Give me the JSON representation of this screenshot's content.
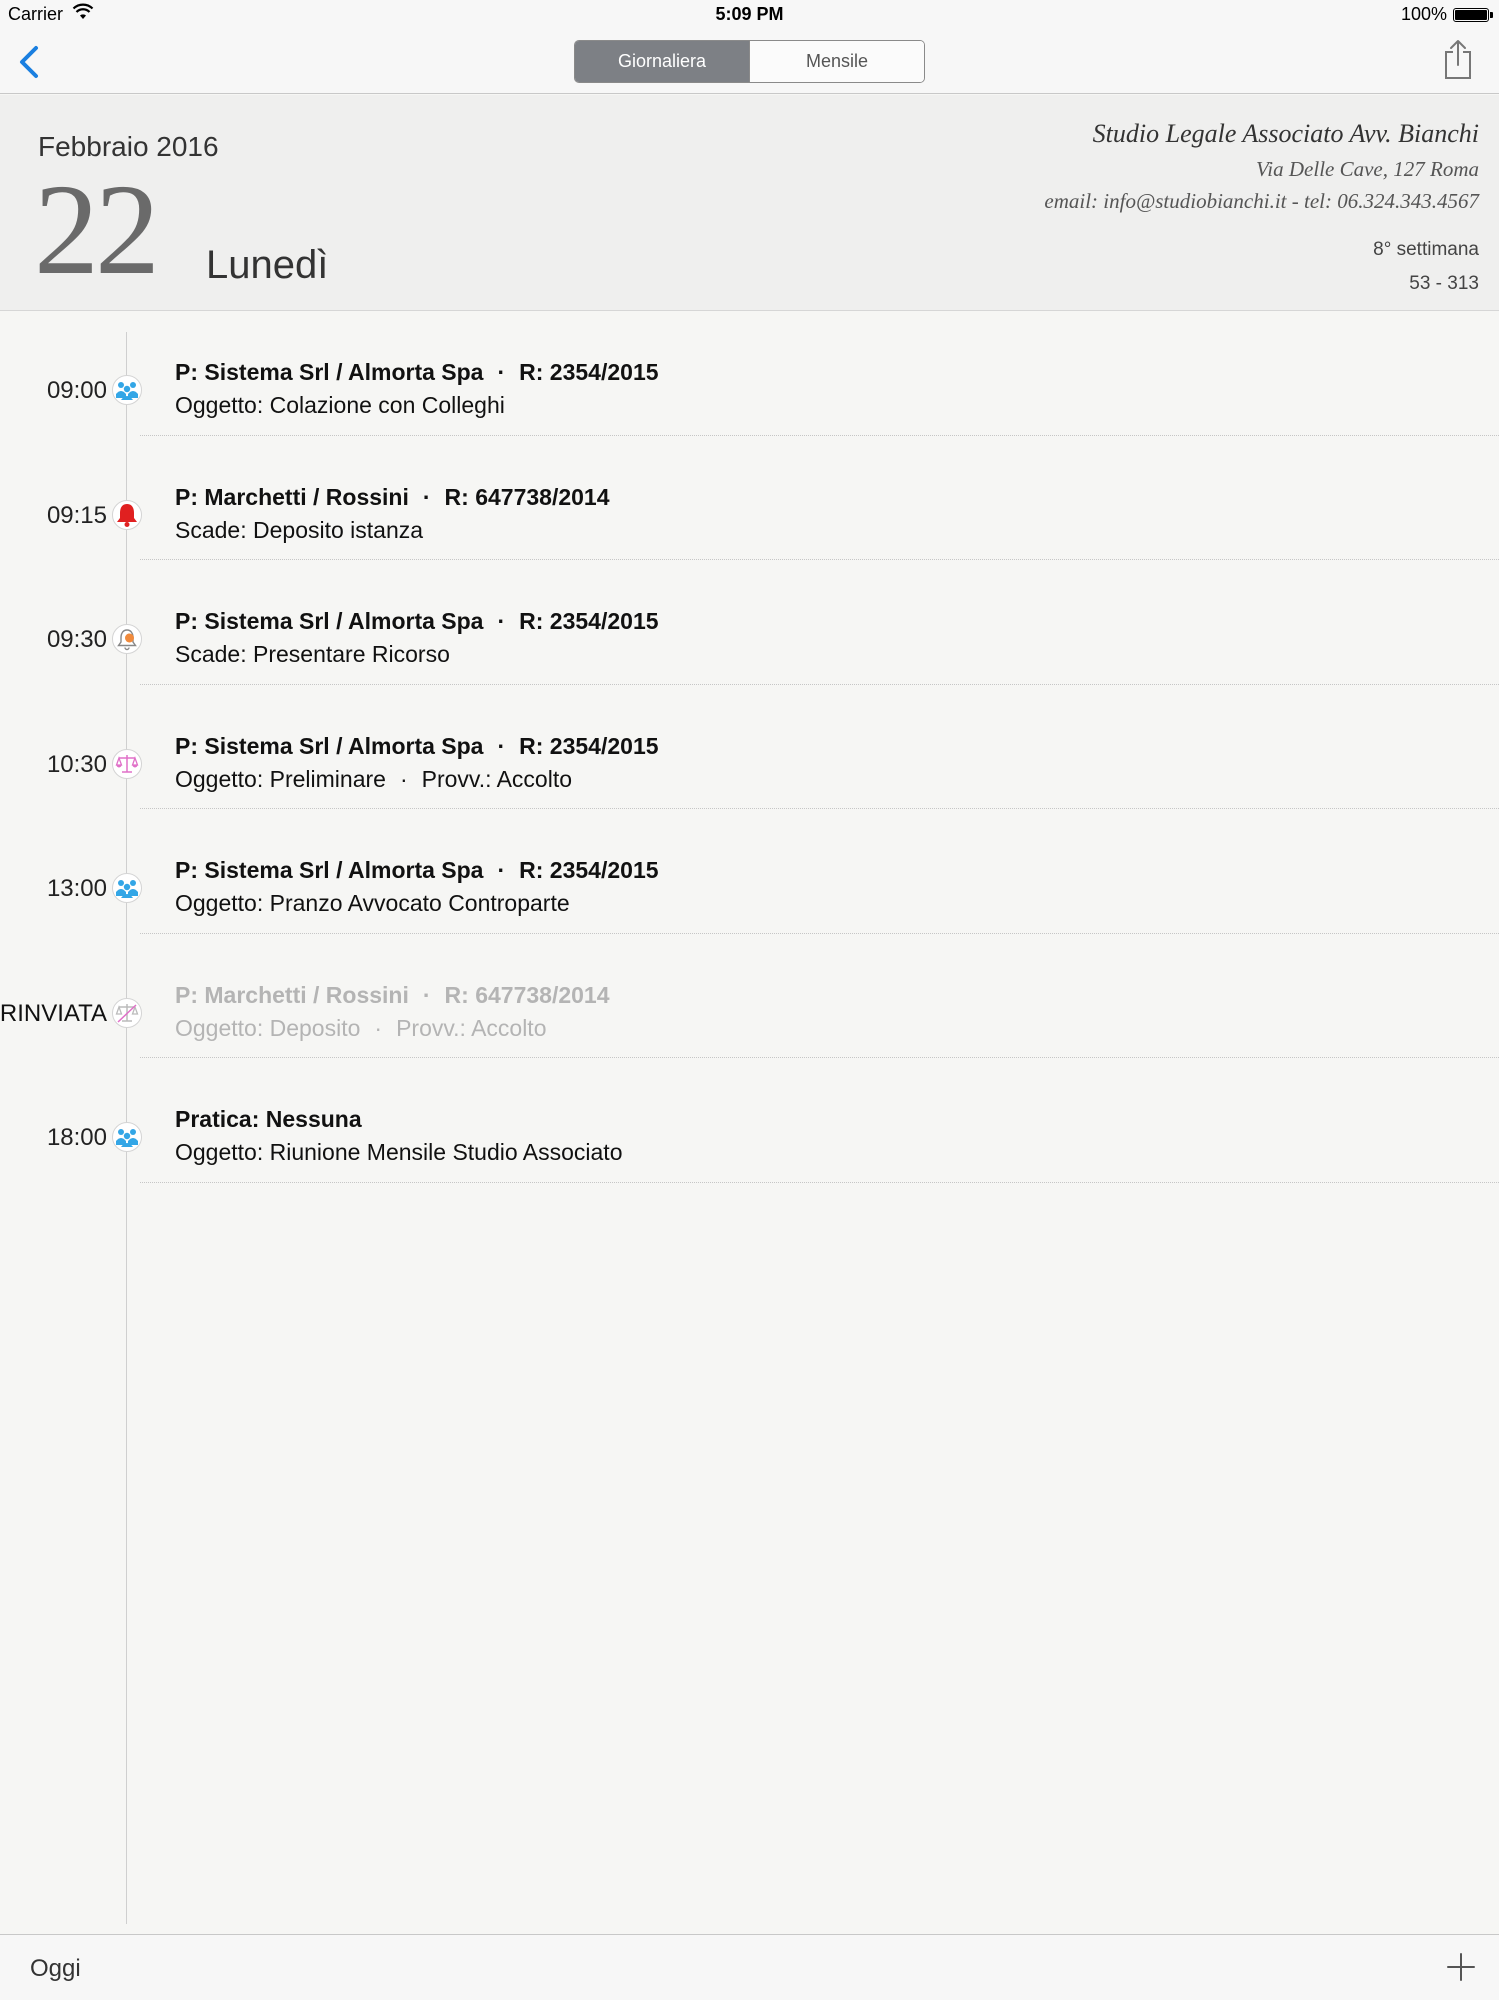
{
  "status": {
    "carrier": "Carrier",
    "time": "5:09 PM",
    "battery": "100%"
  },
  "nav": {
    "segments": [
      "Giornaliera",
      "Mensile"
    ],
    "active_segment": 0
  },
  "header": {
    "month_year": "Febbraio 2016",
    "day": "22",
    "weekday": "Lunedì",
    "studio_name": "Studio Legale Associato Avv. Bianchi",
    "studio_address": "Via Delle Cave, 127 Roma",
    "studio_contact": "email: info@studiobianchi.it  -  tel: 06.324.343.4567",
    "week": "8° settimana",
    "day_count": "53 - 313"
  },
  "events": [
    {
      "time": "09:00",
      "icon": "meeting-people-icon",
      "line1": [
        "P: Sistema Srl / Almorta Spa",
        "R: 2354/2015"
      ],
      "line2": [
        "Oggetto: Colazione con Colleghi"
      ],
      "postponed": false
    },
    {
      "time": "09:15",
      "icon": "red-bell-icon",
      "line1": [
        "P: Marchetti / Rossini",
        "R: 647738/2014"
      ],
      "line2": [
        "Scade: Deposito istanza"
      ],
      "postponed": false
    },
    {
      "time": "09:30",
      "icon": "orange-bell-icon",
      "line1": [
        "P: Sistema Srl / Almorta Spa",
        "R: 2354/2015"
      ],
      "line2": [
        "Scade: Presentare Ricorso"
      ],
      "postponed": false
    },
    {
      "time": "10:30",
      "icon": "scales-icon",
      "line1": [
        "P: Sistema Srl / Almorta Spa",
        "R: 2354/2015"
      ],
      "line2": [
        "Oggetto: Preliminare",
        "Provv.: Accolto"
      ],
      "postponed": false
    },
    {
      "time": "13:00",
      "icon": "meeting-people-icon",
      "line1": [
        "P: Sistema Srl / Almorta Spa",
        "R: 2354/2015"
      ],
      "line2": [
        "Oggetto: Pranzo Avvocato Controparte"
      ],
      "postponed": false
    },
    {
      "time": "RINVIATA",
      "icon": "scales-postponed-icon",
      "line1": [
        "P: Marchetti / Rossini",
        "R: 647738/2014"
      ],
      "line2": [
        "Oggetto: Deposito",
        "Provv.: Accolto"
      ],
      "postponed": true
    },
    {
      "time": "18:00",
      "icon": "meeting-people-icon",
      "line1": [
        "Pratica: Nessuna"
      ],
      "line2": [
        "Oggetto: Riunione Mensile Studio Associato"
      ],
      "postponed": false
    }
  ],
  "toolbar": {
    "today_label": "Oggi"
  },
  "colors": {
    "accent_blue": "#1a7fe0",
    "meeting_icon": "#33a6e6",
    "bell_red": "#e02020",
    "bell_orange": "#f08a3c",
    "scales_pink": "#e070c8",
    "postponed_text": "#b4b4b4"
  }
}
